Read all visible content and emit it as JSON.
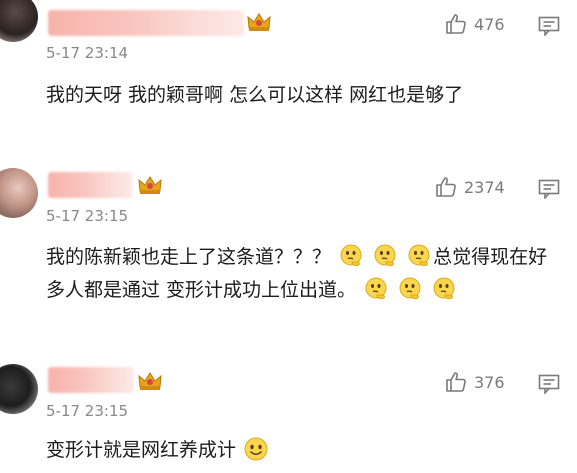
{
  "comments": [
    {
      "time": "5-17 23:14",
      "likes": "476",
      "text": "我的天呀  我的颖哥啊  怎么可以这样  网红也是够了",
      "emoji_count": 0
    },
    {
      "time": "5-17 23:15",
      "likes": "2374",
      "text_a": "我的陈新颖也走上了这条道？？？",
      "text_b": "总觉得现在好多人都是通过 变形计成功上位出道。",
      "emoji_count": 6,
      "emoji_name": "thinking-face"
    },
    {
      "time": "5-17 23:15",
      "likes": "376",
      "text": "变形计就是网红养成计",
      "emoji_count": 1,
      "emoji_name": "smiling-face"
    }
  ],
  "colors": {
    "username_blur": "#f7b3ac",
    "crown_gold": "#e8a317",
    "crown_red": "#d64545",
    "meta_gray": "#888888",
    "text": "#1c1c1c"
  }
}
